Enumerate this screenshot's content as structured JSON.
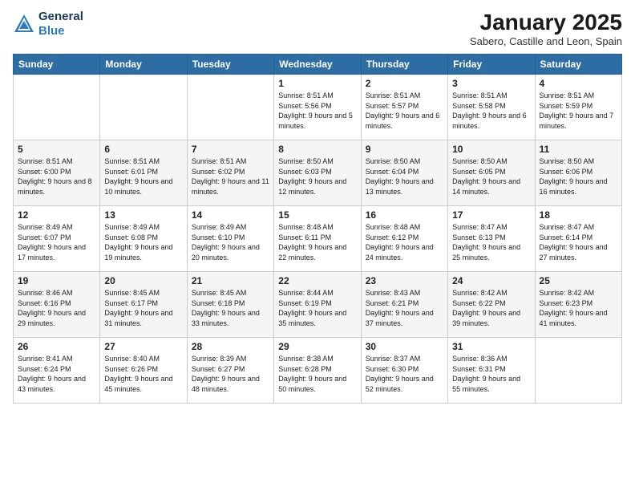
{
  "header": {
    "logo_line1": "General",
    "logo_line2": "Blue",
    "title": "January 2025",
    "subtitle": "Sabero, Castille and Leon, Spain"
  },
  "days_of_week": [
    "Sunday",
    "Monday",
    "Tuesday",
    "Wednesday",
    "Thursday",
    "Friday",
    "Saturday"
  ],
  "weeks": [
    [
      {
        "day": "",
        "info": ""
      },
      {
        "day": "",
        "info": ""
      },
      {
        "day": "",
        "info": ""
      },
      {
        "day": "1",
        "info": "Sunrise: 8:51 AM\nSunset: 5:56 PM\nDaylight: 9 hours and 5 minutes."
      },
      {
        "day": "2",
        "info": "Sunrise: 8:51 AM\nSunset: 5:57 PM\nDaylight: 9 hours and 6 minutes."
      },
      {
        "day": "3",
        "info": "Sunrise: 8:51 AM\nSunset: 5:58 PM\nDaylight: 9 hours and 6 minutes."
      },
      {
        "day": "4",
        "info": "Sunrise: 8:51 AM\nSunset: 5:59 PM\nDaylight: 9 hours and 7 minutes."
      }
    ],
    [
      {
        "day": "5",
        "info": "Sunrise: 8:51 AM\nSunset: 6:00 PM\nDaylight: 9 hours and 8 minutes."
      },
      {
        "day": "6",
        "info": "Sunrise: 8:51 AM\nSunset: 6:01 PM\nDaylight: 9 hours and 10 minutes."
      },
      {
        "day": "7",
        "info": "Sunrise: 8:51 AM\nSunset: 6:02 PM\nDaylight: 9 hours and 11 minutes."
      },
      {
        "day": "8",
        "info": "Sunrise: 8:50 AM\nSunset: 6:03 PM\nDaylight: 9 hours and 12 minutes."
      },
      {
        "day": "9",
        "info": "Sunrise: 8:50 AM\nSunset: 6:04 PM\nDaylight: 9 hours and 13 minutes."
      },
      {
        "day": "10",
        "info": "Sunrise: 8:50 AM\nSunset: 6:05 PM\nDaylight: 9 hours and 14 minutes."
      },
      {
        "day": "11",
        "info": "Sunrise: 8:50 AM\nSunset: 6:06 PM\nDaylight: 9 hours and 16 minutes."
      }
    ],
    [
      {
        "day": "12",
        "info": "Sunrise: 8:49 AM\nSunset: 6:07 PM\nDaylight: 9 hours and 17 minutes."
      },
      {
        "day": "13",
        "info": "Sunrise: 8:49 AM\nSunset: 6:08 PM\nDaylight: 9 hours and 19 minutes."
      },
      {
        "day": "14",
        "info": "Sunrise: 8:49 AM\nSunset: 6:10 PM\nDaylight: 9 hours and 20 minutes."
      },
      {
        "day": "15",
        "info": "Sunrise: 8:48 AM\nSunset: 6:11 PM\nDaylight: 9 hours and 22 minutes."
      },
      {
        "day": "16",
        "info": "Sunrise: 8:48 AM\nSunset: 6:12 PM\nDaylight: 9 hours and 24 minutes."
      },
      {
        "day": "17",
        "info": "Sunrise: 8:47 AM\nSunset: 6:13 PM\nDaylight: 9 hours and 25 minutes."
      },
      {
        "day": "18",
        "info": "Sunrise: 8:47 AM\nSunset: 6:14 PM\nDaylight: 9 hours and 27 minutes."
      }
    ],
    [
      {
        "day": "19",
        "info": "Sunrise: 8:46 AM\nSunset: 6:16 PM\nDaylight: 9 hours and 29 minutes."
      },
      {
        "day": "20",
        "info": "Sunrise: 8:45 AM\nSunset: 6:17 PM\nDaylight: 9 hours and 31 minutes."
      },
      {
        "day": "21",
        "info": "Sunrise: 8:45 AM\nSunset: 6:18 PM\nDaylight: 9 hours and 33 minutes."
      },
      {
        "day": "22",
        "info": "Sunrise: 8:44 AM\nSunset: 6:19 PM\nDaylight: 9 hours and 35 minutes."
      },
      {
        "day": "23",
        "info": "Sunrise: 8:43 AM\nSunset: 6:21 PM\nDaylight: 9 hours and 37 minutes."
      },
      {
        "day": "24",
        "info": "Sunrise: 8:42 AM\nSunset: 6:22 PM\nDaylight: 9 hours and 39 minutes."
      },
      {
        "day": "25",
        "info": "Sunrise: 8:42 AM\nSunset: 6:23 PM\nDaylight: 9 hours and 41 minutes."
      }
    ],
    [
      {
        "day": "26",
        "info": "Sunrise: 8:41 AM\nSunset: 6:24 PM\nDaylight: 9 hours and 43 minutes."
      },
      {
        "day": "27",
        "info": "Sunrise: 8:40 AM\nSunset: 6:26 PM\nDaylight: 9 hours and 45 minutes."
      },
      {
        "day": "28",
        "info": "Sunrise: 8:39 AM\nSunset: 6:27 PM\nDaylight: 9 hours and 48 minutes."
      },
      {
        "day": "29",
        "info": "Sunrise: 8:38 AM\nSunset: 6:28 PM\nDaylight: 9 hours and 50 minutes."
      },
      {
        "day": "30",
        "info": "Sunrise: 8:37 AM\nSunset: 6:30 PM\nDaylight: 9 hours and 52 minutes."
      },
      {
        "day": "31",
        "info": "Sunrise: 8:36 AM\nSunset: 6:31 PM\nDaylight: 9 hours and 55 minutes."
      },
      {
        "day": "",
        "info": ""
      }
    ]
  ]
}
